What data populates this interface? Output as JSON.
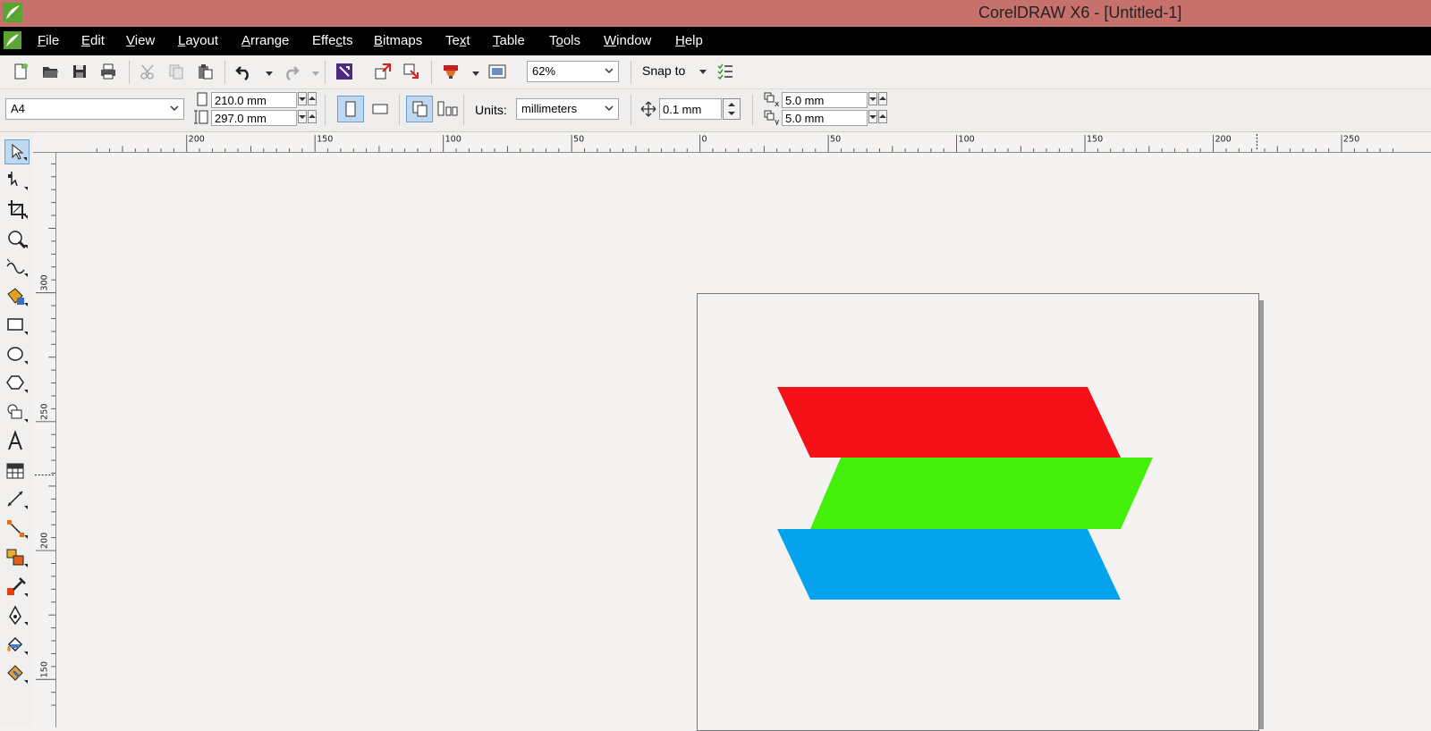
{
  "window": {
    "title": "CorelDRAW X6 - [Untitled-1]"
  },
  "menu": [
    {
      "pre": "",
      "u": "F",
      "post": "ile",
      "name": "menu-file"
    },
    {
      "pre": "",
      "u": "E",
      "post": "dit",
      "name": "menu-edit"
    },
    {
      "pre": "",
      "u": "V",
      "post": "iew",
      "name": "menu-view"
    },
    {
      "pre": "",
      "u": "L",
      "post": "ayout",
      "name": "menu-layout"
    },
    {
      "pre": "",
      "u": "A",
      "post": "rrange",
      "name": "menu-arrange"
    },
    {
      "pre": "Effe",
      "u": "c",
      "post": "ts",
      "name": "menu-effects"
    },
    {
      "pre": "",
      "u": "B",
      "post": "itmaps",
      "name": "menu-bitmaps"
    },
    {
      "pre": "Te",
      "u": "x",
      "post": "t",
      "name": "menu-text"
    },
    {
      "pre": "",
      "u": "T",
      "post": "able",
      "name": "menu-table"
    },
    {
      "pre": "T",
      "u": "o",
      "post": "ols",
      "name": "menu-tools"
    },
    {
      "pre": "",
      "u": "W",
      "post": "indow",
      "name": "menu-window"
    },
    {
      "pre": "",
      "u": "H",
      "post": "elp",
      "name": "menu-help"
    }
  ],
  "standard_toolbar": {
    "zoom_level": "62%",
    "snap_to_label": "Snap to"
  },
  "property_bar": {
    "page_size": "A4",
    "page_width": "210.0 mm",
    "page_height": "297.0 mm",
    "units_label": "Units:",
    "units_value": "millimeters",
    "nudge_distance": "0.1 mm",
    "duplicate_x": "5.0 mm",
    "duplicate_y": "5.0 mm"
  },
  "rulers": {
    "horizontal_labels": [
      "200",
      "150",
      "100",
      "50",
      "0",
      "50",
      "100",
      "150",
      "200",
      "250"
    ],
    "vertical_labels": [
      "300",
      "250",
      "200",
      "150"
    ]
  },
  "drawing": {
    "shapes": [
      {
        "name": "red-parallelogram",
        "fill": "#f50f16"
      },
      {
        "name": "green-parallelogram",
        "fill": "#44f00a"
      },
      {
        "name": "blue-parallelogram",
        "fill": "#05a2ee"
      }
    ]
  },
  "colors": {
    "titlebar": "#c6716b",
    "menubar": "#000000",
    "active_tool": "#bfd8f2"
  }
}
